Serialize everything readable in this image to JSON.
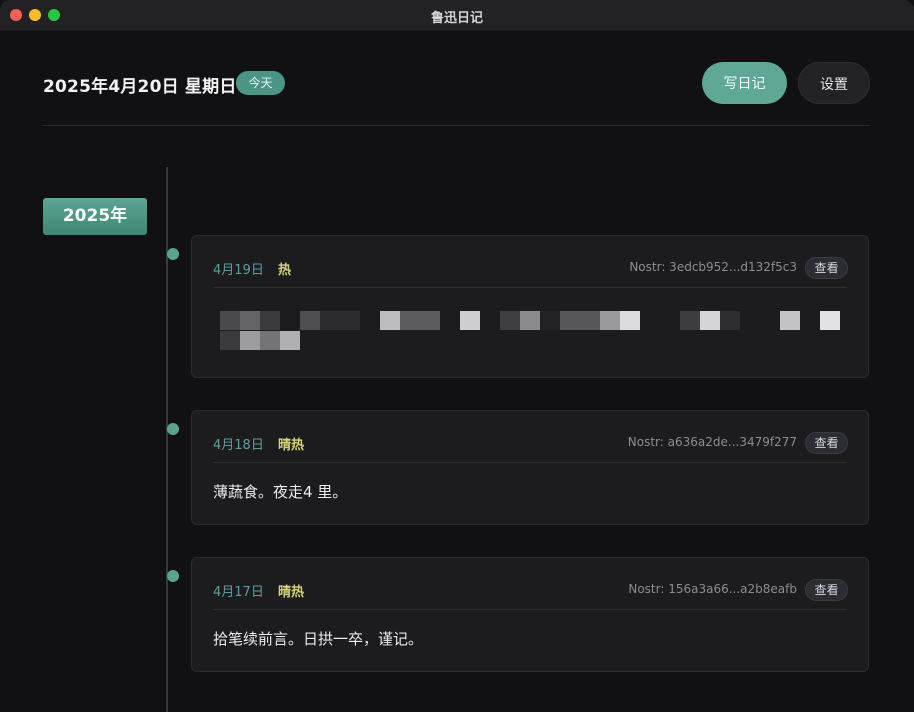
{
  "window": {
    "title": "鲁迅日记"
  },
  "header": {
    "date": "2025年4月20日 星期日",
    "today_badge": "今天",
    "write_button": "写日记",
    "settings_button": "设置"
  },
  "timeline": {
    "year": "2025年"
  },
  "entries": [
    {
      "date": "4月19日",
      "weather": "热",
      "nostr": "Nostr: 3edcb952...d132f5c3",
      "view_label": "查看",
      "content": "",
      "content_obscured": true
    },
    {
      "date": "4月18日",
      "weather": "晴热",
      "nostr": "Nostr: a636a2de...3479f277",
      "view_label": "查看",
      "content": "薄蔬食。夜走4 里。"
    },
    {
      "date": "4月17日",
      "weather": "晴热",
      "nostr": "Nostr: 156a3a66...a2b8eafb",
      "view_label": "查看",
      "content": "拾笔续前言。日拱一卒，谨记。"
    }
  ],
  "colors": {
    "accent": "#5ea895",
    "weather": "#d6d47a",
    "date": "#5a9fa0",
    "background": "#111113",
    "card": "#1c1c1f"
  }
}
